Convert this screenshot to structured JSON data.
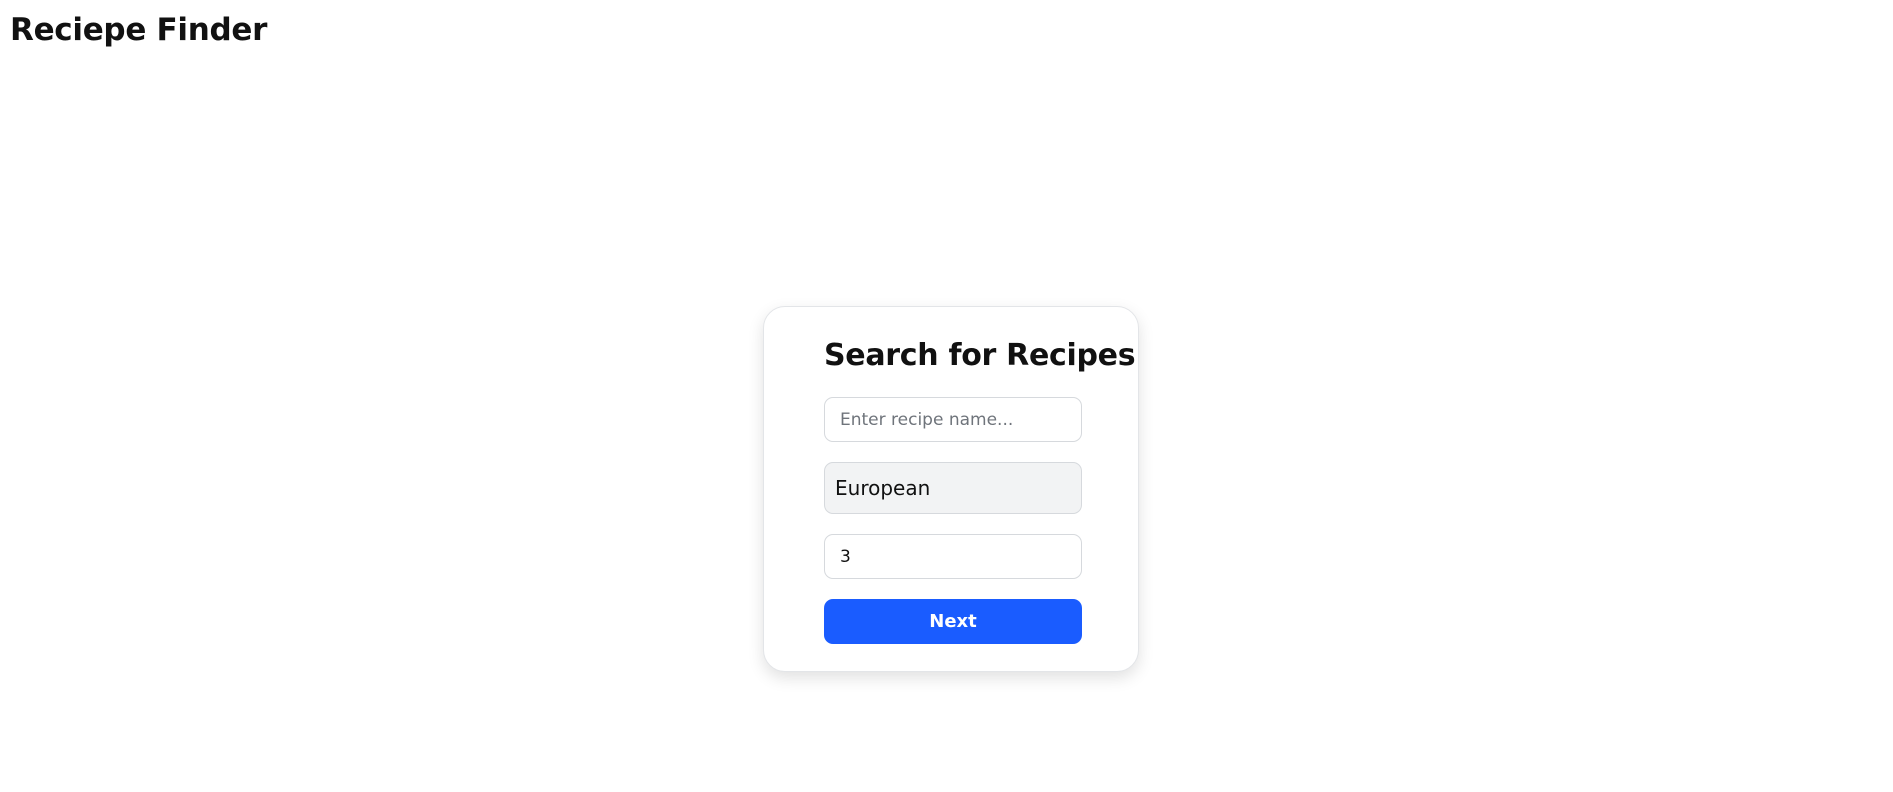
{
  "header": {
    "app_title": "Reciepe Finder"
  },
  "search_card": {
    "title": "Search for Recipes",
    "recipe_name_input": {
      "value": "",
      "placeholder": "Enter recipe name..."
    },
    "cuisine_select": {
      "selected": "European"
    },
    "count_input": {
      "value": "3"
    },
    "next_label": "Next"
  },
  "colors": {
    "accent": "#1a5cff",
    "select_background": "#f2f3f4"
  }
}
